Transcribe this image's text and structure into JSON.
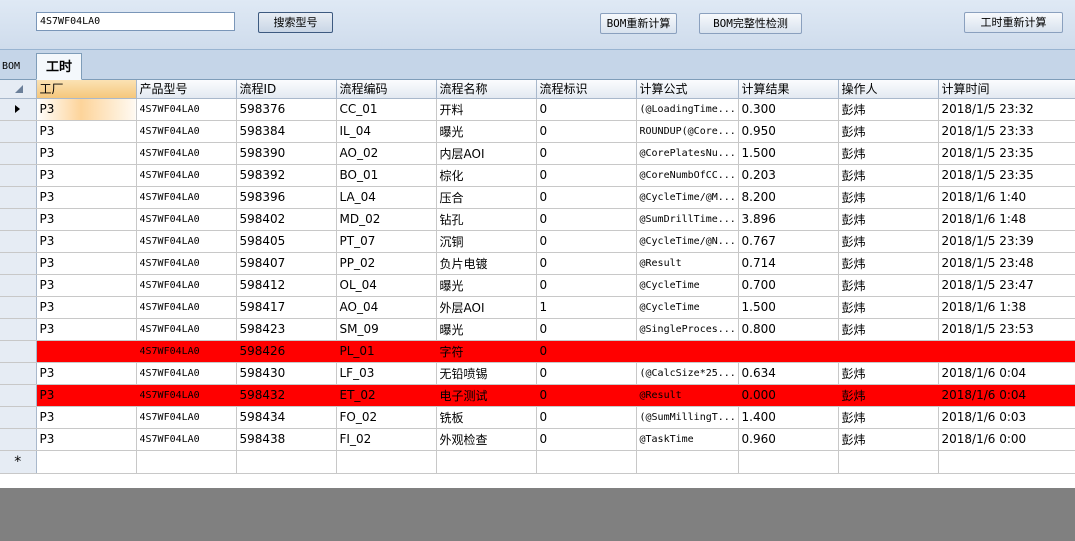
{
  "toolbar": {
    "search_value": "4S7WF04LA0",
    "search_button": "搜索型号",
    "bom_recalc_button": "BOM重新计算",
    "bom_check_button": "BOM完整性检测",
    "hours_recalc_button": "工时重新计算"
  },
  "tabs": [
    {
      "label": "BOM"
    },
    {
      "label": "工时"
    }
  ],
  "columns": [
    "工厂",
    "产品型号",
    "流程ID",
    "流程编码",
    "流程名称",
    "流程标识",
    "计算公式",
    "计算结果",
    "操作人",
    "计算时间"
  ],
  "rows": [
    {
      "factory": "P3",
      "model": "4S7WF04LA0",
      "id": "598376",
      "code": "CC_01",
      "name": "开料",
      "flag": "0",
      "formula": " (@LoadingTime...",
      "result": "0.300",
      "operator": "彭炜",
      "time": "2018/1/5 23:32"
    },
    {
      "factory": "P3",
      "model": "4S7WF04LA0",
      "id": "598384",
      "code": "IL_04",
      "name": "曝光",
      "flag": "0",
      "formula": "ROUNDUP(@Core...",
      "result": "0.950",
      "operator": "彭炜",
      "time": "2018/1/5 23:33"
    },
    {
      "factory": "P3",
      "model": "4S7WF04LA0",
      "id": "598390",
      "code": "AO_02",
      "name": "内层AOI",
      "flag": "0",
      "formula": "@CorePlatesNu...",
      "result": "1.500",
      "operator": "彭炜",
      "time": "2018/1/5 23:35"
    },
    {
      "factory": "P3",
      "model": "4S7WF04LA0",
      "id": "598392",
      "code": "BO_01",
      "name": "棕化",
      "flag": "0",
      "formula": "@CoreNumbOfCC...",
      "result": "0.203",
      "operator": "彭炜",
      "time": "2018/1/5 23:35"
    },
    {
      "factory": "P3",
      "model": "4S7WF04LA0",
      "id": "598396",
      "code": "LA_04",
      "name": "压合",
      "flag": "0",
      "formula": "@CycleTime/@M...",
      "result": "8.200",
      "operator": "彭炜",
      "time": "2018/1/6 1:40"
    },
    {
      "factory": "P3",
      "model": "4S7WF04LA0",
      "id": "598402",
      "code": "MD_02",
      "name": "钻孔",
      "flag": "0",
      "formula": "@SumDrillTime...",
      "result": "3.896",
      "operator": "彭炜",
      "time": "2018/1/6 1:48"
    },
    {
      "factory": "P3",
      "model": "4S7WF04LA0",
      "id": "598405",
      "code": "PT_07",
      "name": "沉铜",
      "flag": "0",
      "formula": "@CycleTime/@N...",
      "result": "0.767",
      "operator": "彭炜",
      "time": "2018/1/5 23:39"
    },
    {
      "factory": "P3",
      "model": "4S7WF04LA0",
      "id": "598407",
      "code": "PP_02",
      "name": "负片电镀",
      "flag": "0",
      "formula": "@Result",
      "result": "0.714",
      "operator": "彭炜",
      "time": "2018/1/5 23:48"
    },
    {
      "factory": "P3",
      "model": "4S7WF04LA0",
      "id": "598412",
      "code": "OL_04",
      "name": "曝光",
      "flag": "0",
      "formula": "@CycleTime",
      "result": "0.700",
      "operator": "彭炜",
      "time": "2018/1/5 23:47"
    },
    {
      "factory": "P3",
      "model": "4S7WF04LA0",
      "id": "598417",
      "code": "AO_04",
      "name": "外层AOI",
      "flag": "1",
      "formula": "@CycleTime",
      "result": "1.500",
      "operator": "彭炜",
      "time": "2018/1/6 1:38"
    },
    {
      "factory": "P3",
      "model": "4S7WF04LA0",
      "id": "598423",
      "code": "SM_09",
      "name": "曝光",
      "flag": "0",
      "formula": "@SingleProces...",
      "result": "0.800",
      "operator": "彭炜",
      "time": "2018/1/5 23:53"
    },
    {
      "factory": "",
      "model": "4S7WF04LA0",
      "id": "598426",
      "code": "PL_01",
      "name": "字符",
      "flag": "0",
      "formula": "",
      "result": "",
      "operator": "",
      "time": ""
    },
    {
      "factory": "P3",
      "model": "4S7WF04LA0",
      "id": "598430",
      "code": "LF_03",
      "name": "无铅喷锡",
      "flag": "0",
      "formula": " (@CalcSize*25...",
      "result": "0.634",
      "operator": "彭炜",
      "time": "2018/1/6 0:04"
    },
    {
      "factory": "P3",
      "model": "4S7WF04LA0",
      "id": "598432",
      "code": "ET_02",
      "name": "电子测试",
      "flag": "0",
      "formula": "@Result",
      "result": "0.000",
      "operator": "彭炜",
      "time": "2018/1/6 0:04"
    },
    {
      "factory": "P3",
      "model": "4S7WF04LA0",
      "id": "598434",
      "code": "FO_02",
      "name": "铣板",
      "flag": "0",
      "formula": " (@SumMillingT...",
      "result": "1.400",
      "operator": "彭炜",
      "time": "2018/1/6 0:03"
    },
    {
      "factory": "P3",
      "model": "4S7WF04LA0",
      "id": "598438",
      "code": "FI_02",
      "name": "外观检查",
      "flag": "0",
      "formula": "@TaskTime",
      "result": "0.960",
      "operator": "彭炜",
      "time": "2018/1/6 0:00"
    }
  ],
  "new_row_marker": "*",
  "colors": {
    "error_row": "#ff0000",
    "toolbar_bg": "#dfe9f5",
    "empty_area": "#808080",
    "selected_cell": "#fdd49a"
  },
  "icons": {
    "current_row": "row-pointer-icon",
    "new_row": "new-row-star-icon",
    "select_all": "select-all-icon"
  }
}
